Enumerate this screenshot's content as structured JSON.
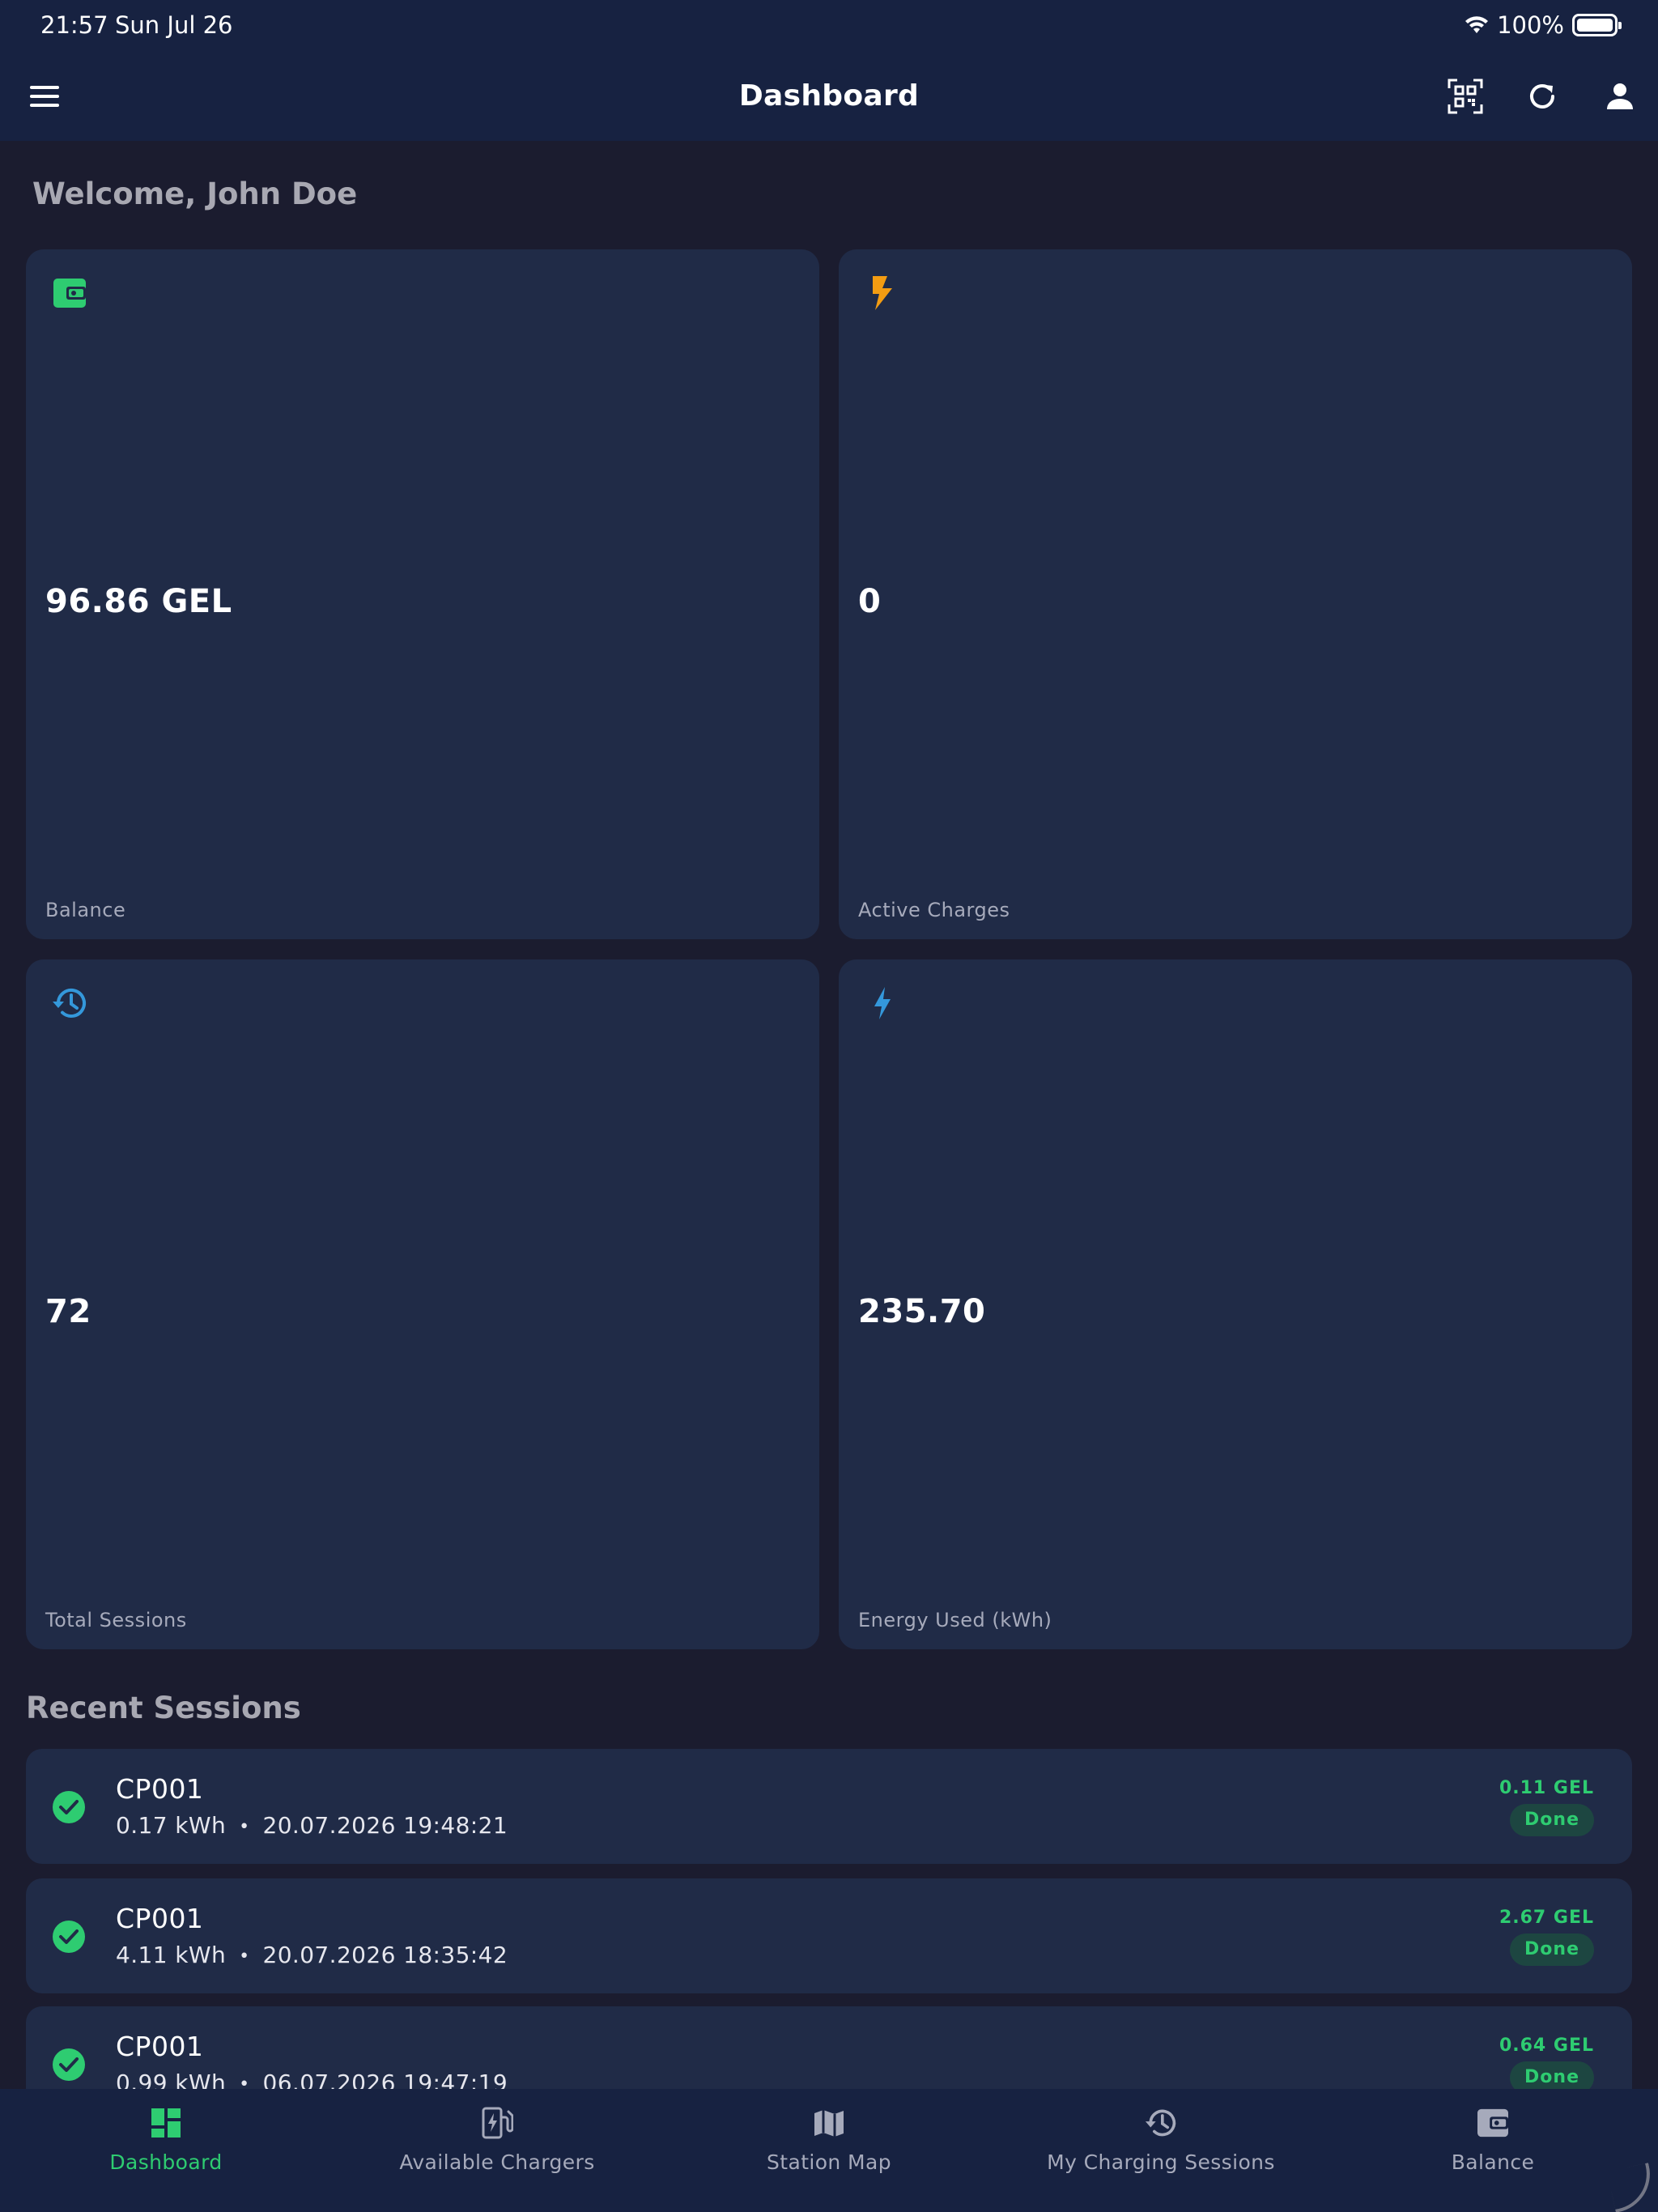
{
  "status_bar": {
    "time": "21:57",
    "date": "Sun Jul 26",
    "battery": "100%"
  },
  "app_bar": {
    "title": "Dashboard"
  },
  "welcome": "Welcome, John Doe",
  "stats": {
    "balance": {
      "value": "96.86 GEL",
      "label": "Balance",
      "icon": "wallet-icon",
      "color": "#2ecc71"
    },
    "active_charges": {
      "value": "0",
      "label": "Active Charges",
      "icon": "flash-icon",
      "color": "#f39c12"
    },
    "total_sessions": {
      "value": "72",
      "label": "Total Sessions",
      "icon": "history-icon",
      "color": "#3498db"
    },
    "energy_used": {
      "value": "235.70",
      "label": "Energy Used (kWh)",
      "icon": "bolt-icon",
      "color": "#3498db"
    }
  },
  "recent_sessions": {
    "title": "Recent Sessions",
    "items": [
      {
        "charger": "CP001",
        "energy": "0.17 kWh",
        "datetime": "20.07.2026 19:48:21",
        "amount": "0.11 GEL",
        "status": "Done"
      },
      {
        "charger": "CP001",
        "energy": "4.11 kWh",
        "datetime": "20.07.2026 18:35:42",
        "amount": "2.67 GEL",
        "status": "Done"
      },
      {
        "charger": "CP001",
        "energy": "0.99 kWh",
        "datetime": "06.07.2026 19:47:19",
        "amount": "0.64 GEL",
        "status": "Done"
      }
    ]
  },
  "bottom_nav": {
    "items": [
      {
        "label": "Dashboard",
        "icon": "dashboard-icon",
        "active": true
      },
      {
        "label": "Available Chargers",
        "icon": "ev-station-icon",
        "active": false
      },
      {
        "label": "Station Map",
        "icon": "map-icon",
        "active": false
      },
      {
        "label": "My Charging Sessions",
        "icon": "history-icon",
        "active": false
      },
      {
        "label": "Balance",
        "icon": "wallet-icon",
        "active": false
      }
    ]
  },
  "colors": {
    "accent": "#2ecc71",
    "warning": "#f39c12",
    "info": "#3498db",
    "background": "#1b1c2f",
    "card": "#202b47",
    "bar": "#172241"
  }
}
